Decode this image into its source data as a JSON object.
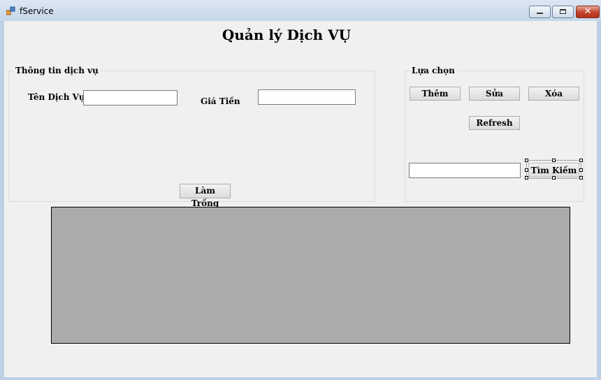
{
  "window": {
    "title": "fService",
    "minimize_icon": "minimize-icon",
    "maximize_icon": "maximize-icon",
    "close_icon": "close-icon",
    "close_glyph": "✕"
  },
  "form": {
    "title": "Quản lý Dịch VỤ"
  },
  "info_group": {
    "label": "Thông tin dịch vụ",
    "service_name_label": "Tên Dịch Vụ",
    "service_name_value": "",
    "price_label": "Giá Tiền",
    "price_value": "",
    "clear_button": "Làm Trống"
  },
  "options_group": {
    "label": "Lựa chọn",
    "add_button": "Thêm",
    "edit_button": "Sửa",
    "delete_button": "Xóa",
    "refresh_button": "Refresh",
    "search_value": "",
    "search_button": "Tìm Kiếm"
  },
  "colors": {
    "titlebar": "#c6d7ea",
    "client": "#f0f0f0",
    "grid_background": "#ababab",
    "close_button": "#c3432c"
  }
}
